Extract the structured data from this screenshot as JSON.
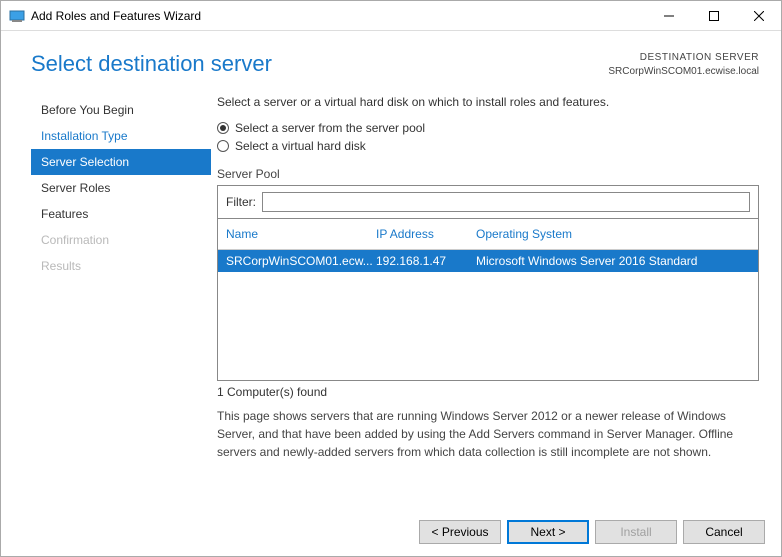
{
  "window": {
    "title": "Add Roles and Features Wizard"
  },
  "header": {
    "page_title": "Select destination server",
    "dest_label": "DESTINATION SERVER",
    "dest_value": "SRCorpWinSCOM01.ecwise.local"
  },
  "sidebar": {
    "items": [
      {
        "label": "Before You Begin",
        "state": "normal"
      },
      {
        "label": "Installation Type",
        "state": "link"
      },
      {
        "label": "Server Selection",
        "state": "selected"
      },
      {
        "label": "Server Roles",
        "state": "normal"
      },
      {
        "label": "Features",
        "state": "normal"
      },
      {
        "label": "Confirmation",
        "state": "disabled"
      },
      {
        "label": "Results",
        "state": "disabled"
      }
    ]
  },
  "content": {
    "instruction": "Select a server or a virtual hard disk on which to install roles and features.",
    "radio1": "Select a server from the server pool",
    "radio2": "Select a virtual hard disk",
    "radio_selected": 0,
    "pool_label": "Server Pool",
    "filter_label": "Filter:",
    "filter_value": "",
    "columns": {
      "name": "Name",
      "ip": "IP Address",
      "os": "Operating System"
    },
    "rows": [
      {
        "name": "SRCorpWinSCOM01.ecw...",
        "ip": "192.168.1.47",
        "os": "Microsoft Windows Server 2016 Standard"
      }
    ],
    "count": "1 Computer(s) found",
    "note": "This page shows servers that are running Windows Server 2012 or a newer release of Windows Server, and that have been added by using the Add Servers command in Server Manager. Offline servers and newly-added servers from which data collection is still incomplete are not shown."
  },
  "footer": {
    "prev": "< Previous",
    "next": "Next >",
    "install": "Install",
    "cancel": "Cancel"
  }
}
